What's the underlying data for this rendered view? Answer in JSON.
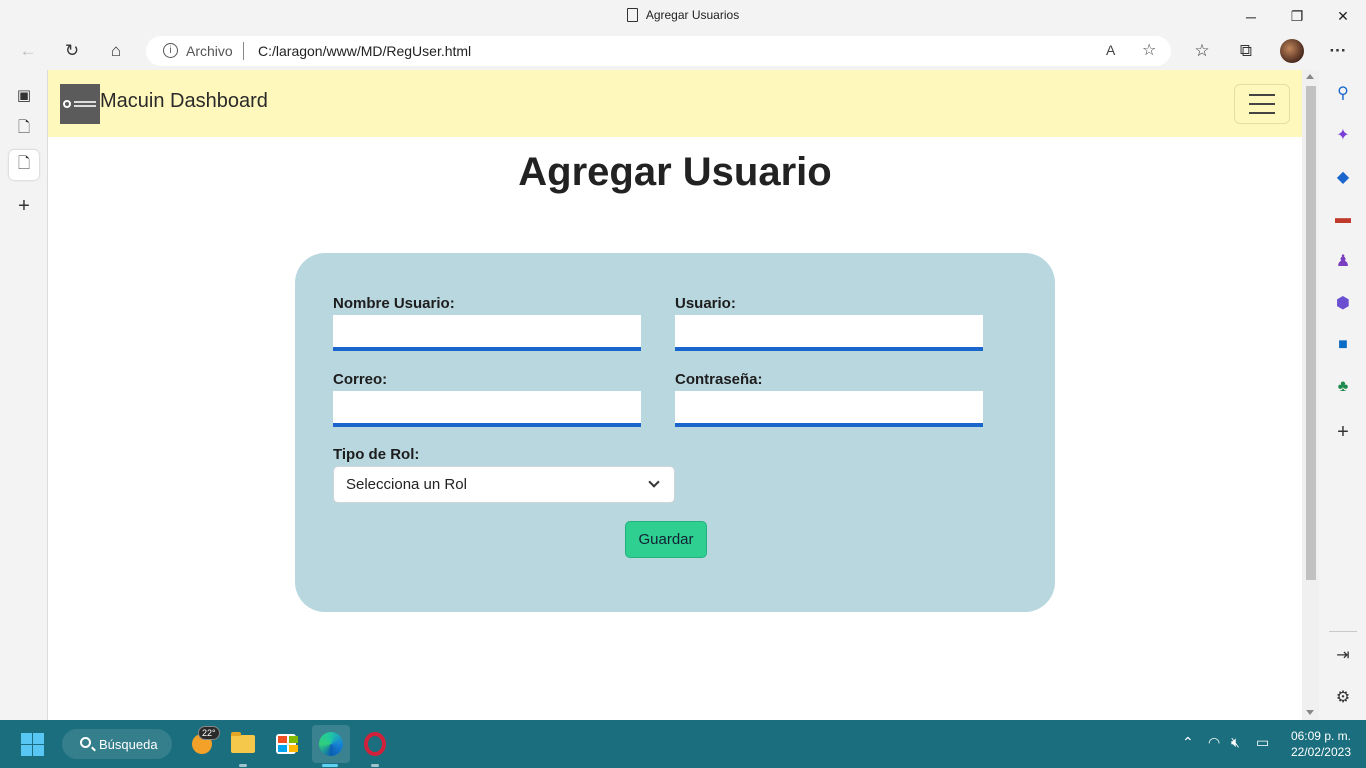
{
  "window": {
    "title": "Agregar Usuarios",
    "minimize": "─",
    "restore": "❐",
    "close": "✕"
  },
  "toolbar": {
    "back_icon": "←",
    "refresh_icon": "↻",
    "home_icon": "⌂",
    "address": {
      "protocol_label": "Archivo",
      "url": "C:/laragon/www/MD/RegUser.html"
    },
    "read_aloud_icon": "A",
    "add_favorite_icon": "☆",
    "favorites_icon": "☆",
    "collections_icon": "⧉",
    "more_icon": "···"
  },
  "page": {
    "brand": "Macuin Dashboard",
    "heading": "Agregar Usuario",
    "form": {
      "nombre_label": "Nombre Usuario:",
      "nombre_value": "",
      "usuario_label": "Usuario:",
      "usuario_value": "",
      "correo_label": "Correo:",
      "correo_value": "",
      "contrasena_label": "Contraseña:",
      "contrasena_value": "",
      "rol_label": "Tipo de Rol:",
      "rol_selected": "Selecciona un Rol",
      "save_label": "Guardar"
    }
  },
  "taskbar": {
    "search_label": "Búsqueda",
    "weather_temp": "22°",
    "time": "06:09 p. m.",
    "date": "22/02/2023"
  },
  "colors": {
    "navbar_bg": "#fff8bd",
    "card_bg": "#b9d7df",
    "input_underline": "#1a66cc",
    "save_button": "#2fcf91",
    "taskbar": "#1a6e7d"
  }
}
